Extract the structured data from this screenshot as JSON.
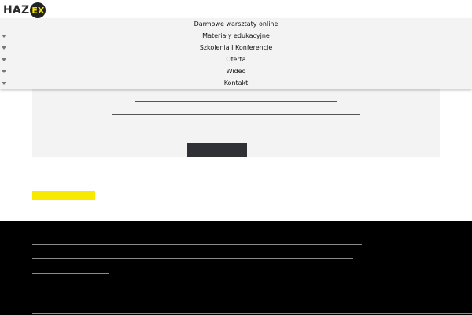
{
  "logo": {
    "text": "HAZ",
    "badge": "EX"
  },
  "nav": {
    "items": [
      {
        "label": "Darmowe warsztaty online",
        "has_submenu": false
      },
      {
        "label": "Materiały edukacyjne",
        "has_submenu": true
      },
      {
        "label": "Szkolenia I Konferencje",
        "has_submenu": true
      },
      {
        "label": "Oferta",
        "has_submenu": true
      },
      {
        "label": "Wideo",
        "has_submenu": true
      },
      {
        "label": "Kontakt",
        "has_submenu": true
      }
    ]
  },
  "colors": {
    "accent_yellow": "#f7ea00",
    "footer_bg": "#000000",
    "panel_bg": "#f3f3f3",
    "button_dark": "#2f3136"
  }
}
